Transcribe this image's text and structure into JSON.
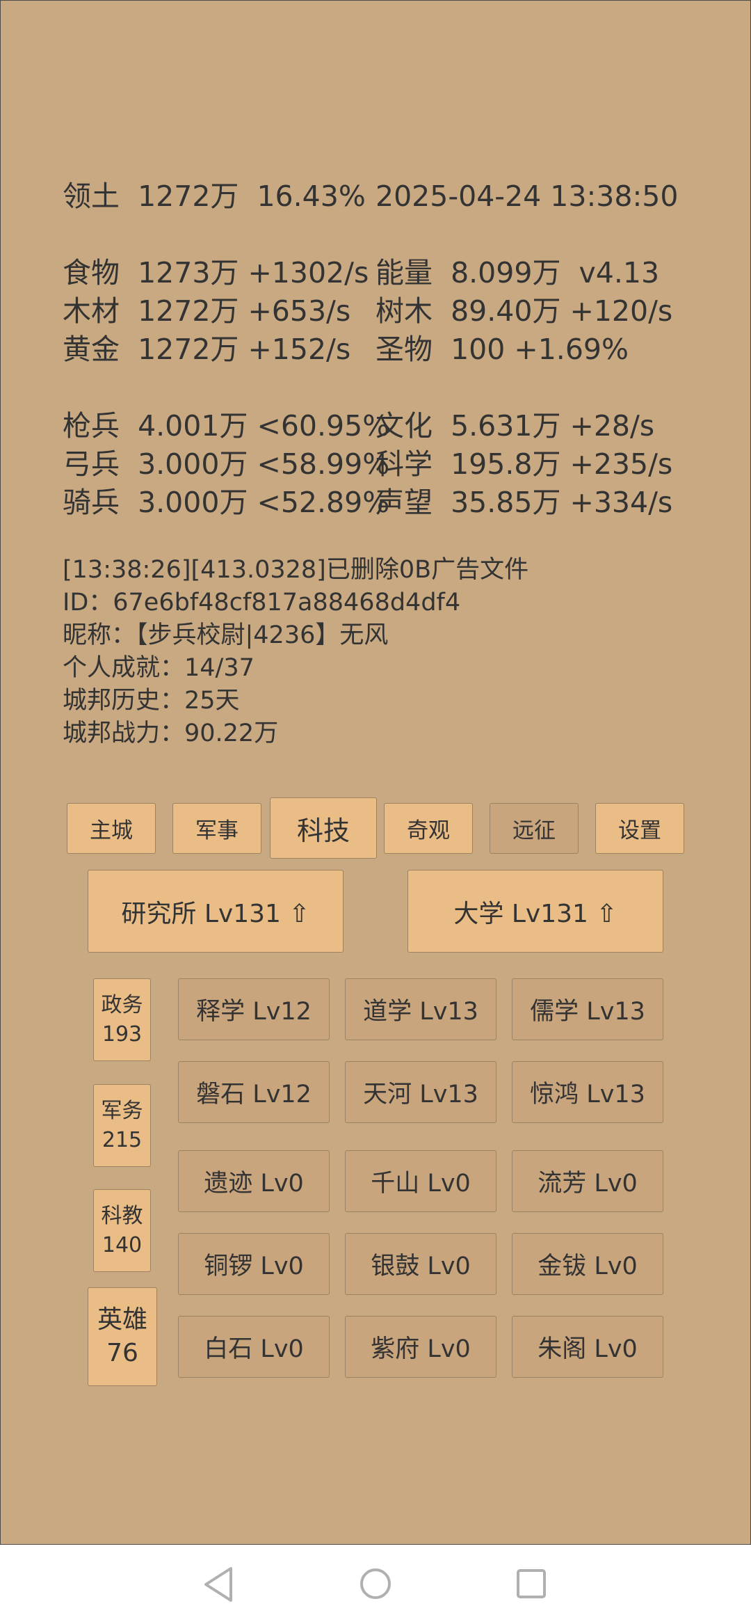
{
  "stats": {
    "territory": "领土  1272万  16.43%",
    "datetime": "2025-04-24 13:38:50",
    "food": "食物  1273万 +1302/s",
    "energy": "能量  8.099万  v4.13",
    "wood": "木材  1272万 +653/s",
    "trees": "树木  89.40万 +120/s",
    "gold": "黄金  1272万 +152/s",
    "relic": "圣物  100 +1.69%",
    "spear": "枪兵  4.001万 <60.95%",
    "culture": "文化  5.631万 +28/s",
    "archer": "弓兵  3.000万 <58.99%",
    "science": "科学  195.8万 +235/s",
    "cavalry": "骑兵  3.000万 <52.89%",
    "prestige": "声望  35.85万 +334/s"
  },
  "info": {
    "log": "[13:38:26][413.0328]已删除0B广告文件",
    "id": "ID：67e6bf48cf817a88468d4df4",
    "nickname": "昵称：【步兵校尉|4236】无风",
    "achievement": "个人成就：14/37",
    "history": "城邦历史：25天",
    "power": "城邦战力：90.22万"
  },
  "nav": {
    "main_city": "主城",
    "military": "军事",
    "tech": "科技",
    "wonders": "奇观",
    "expedition": "远征",
    "settings": "设置"
  },
  "buildings": {
    "institute": "研究所 Lv131 ⇧",
    "university": "大学 Lv131 ⇧"
  },
  "side": {
    "politics_label": "政务",
    "politics_value": "193",
    "military_label": "军务",
    "military_value": "215",
    "education_label": "科教",
    "education_value": "140",
    "hero_label": "英雄",
    "hero_value": "76"
  },
  "techs": {
    "r1": [
      "释学 Lv12",
      "道学 Lv13",
      "儒学 Lv13"
    ],
    "r2": [
      "磐石 Lv12",
      "天河 Lv13",
      "惊鸿 Lv13"
    ],
    "r3": [
      "遗迹 Lv0",
      "千山 Lv0",
      "流芳 Lv0"
    ],
    "r4": [
      "铜锣 Lv0",
      "银鼓 Lv0",
      "金钹 Lv0"
    ],
    "r5": [
      "白石 Lv0",
      "紫府 Lv0",
      "朱阁 Lv0"
    ]
  },
  "icons": {
    "back": "back-triangle-icon",
    "home": "home-circle-icon",
    "recents": "recents-square-icon"
  },
  "colors": {
    "background": "#c9a982",
    "button_light": "#ebbd86",
    "button_dark": "#c9a57d"
  }
}
